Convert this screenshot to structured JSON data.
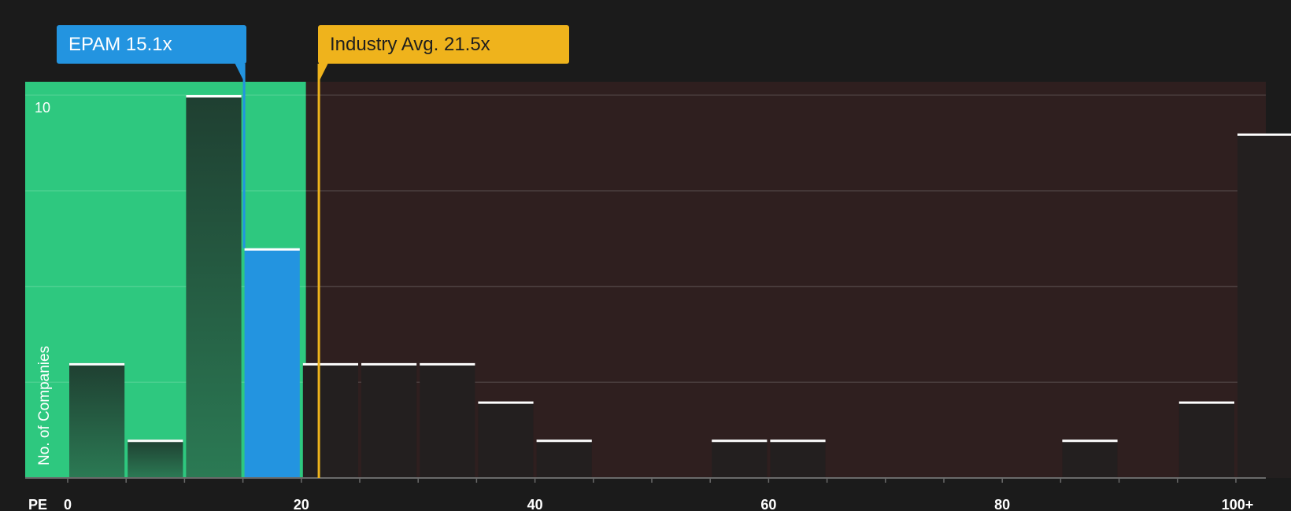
{
  "company_label": "EPAM 15.1x",
  "industry_label": "Industry Avg. 21.5x",
  "colors": {
    "background": "#1b1b1b",
    "undervalued_zone": "#2ec87f",
    "overvalued_zone": "#2f1f1f",
    "company_bar": "#2394e0",
    "industry_line": "#efb31c",
    "bar_cap": "#ffffff"
  },
  "chart_data": {
    "type": "bar",
    "xlabel": "PE",
    "ylabel": "No. of Companies",
    "x_ticks": [
      "0",
      "20",
      "40",
      "60",
      "80",
      "100+"
    ],
    "y_ticks": [
      "10"
    ],
    "ylim": [
      0,
      10
    ],
    "bin_width": 5,
    "bins": [
      {
        "start": 0,
        "count": 3
      },
      {
        "start": 5,
        "count": 1
      },
      {
        "start": 10,
        "count": 10
      },
      {
        "start": 15,
        "count": 6
      },
      {
        "start": 20,
        "count": 3
      },
      {
        "start": 25,
        "count": 3
      },
      {
        "start": 30,
        "count": 3
      },
      {
        "start": 35,
        "count": 2
      },
      {
        "start": 40,
        "count": 1
      },
      {
        "start": 45,
        "count": 0
      },
      {
        "start": 50,
        "count": 0
      },
      {
        "start": 55,
        "count": 1
      },
      {
        "start": 60,
        "count": 1
      },
      {
        "start": 65,
        "count": 0
      },
      {
        "start": 70,
        "count": 0
      },
      {
        "start": 75,
        "count": 0
      },
      {
        "start": 80,
        "count": 0
      },
      {
        "start": 85,
        "count": 1
      },
      {
        "start": 90,
        "count": 0
      },
      {
        "start": 95,
        "count": 2
      },
      {
        "start": 100,
        "count": 9
      }
    ],
    "company_value": 15.1,
    "company_bin_start": 15,
    "industry_avg": 21.5
  }
}
